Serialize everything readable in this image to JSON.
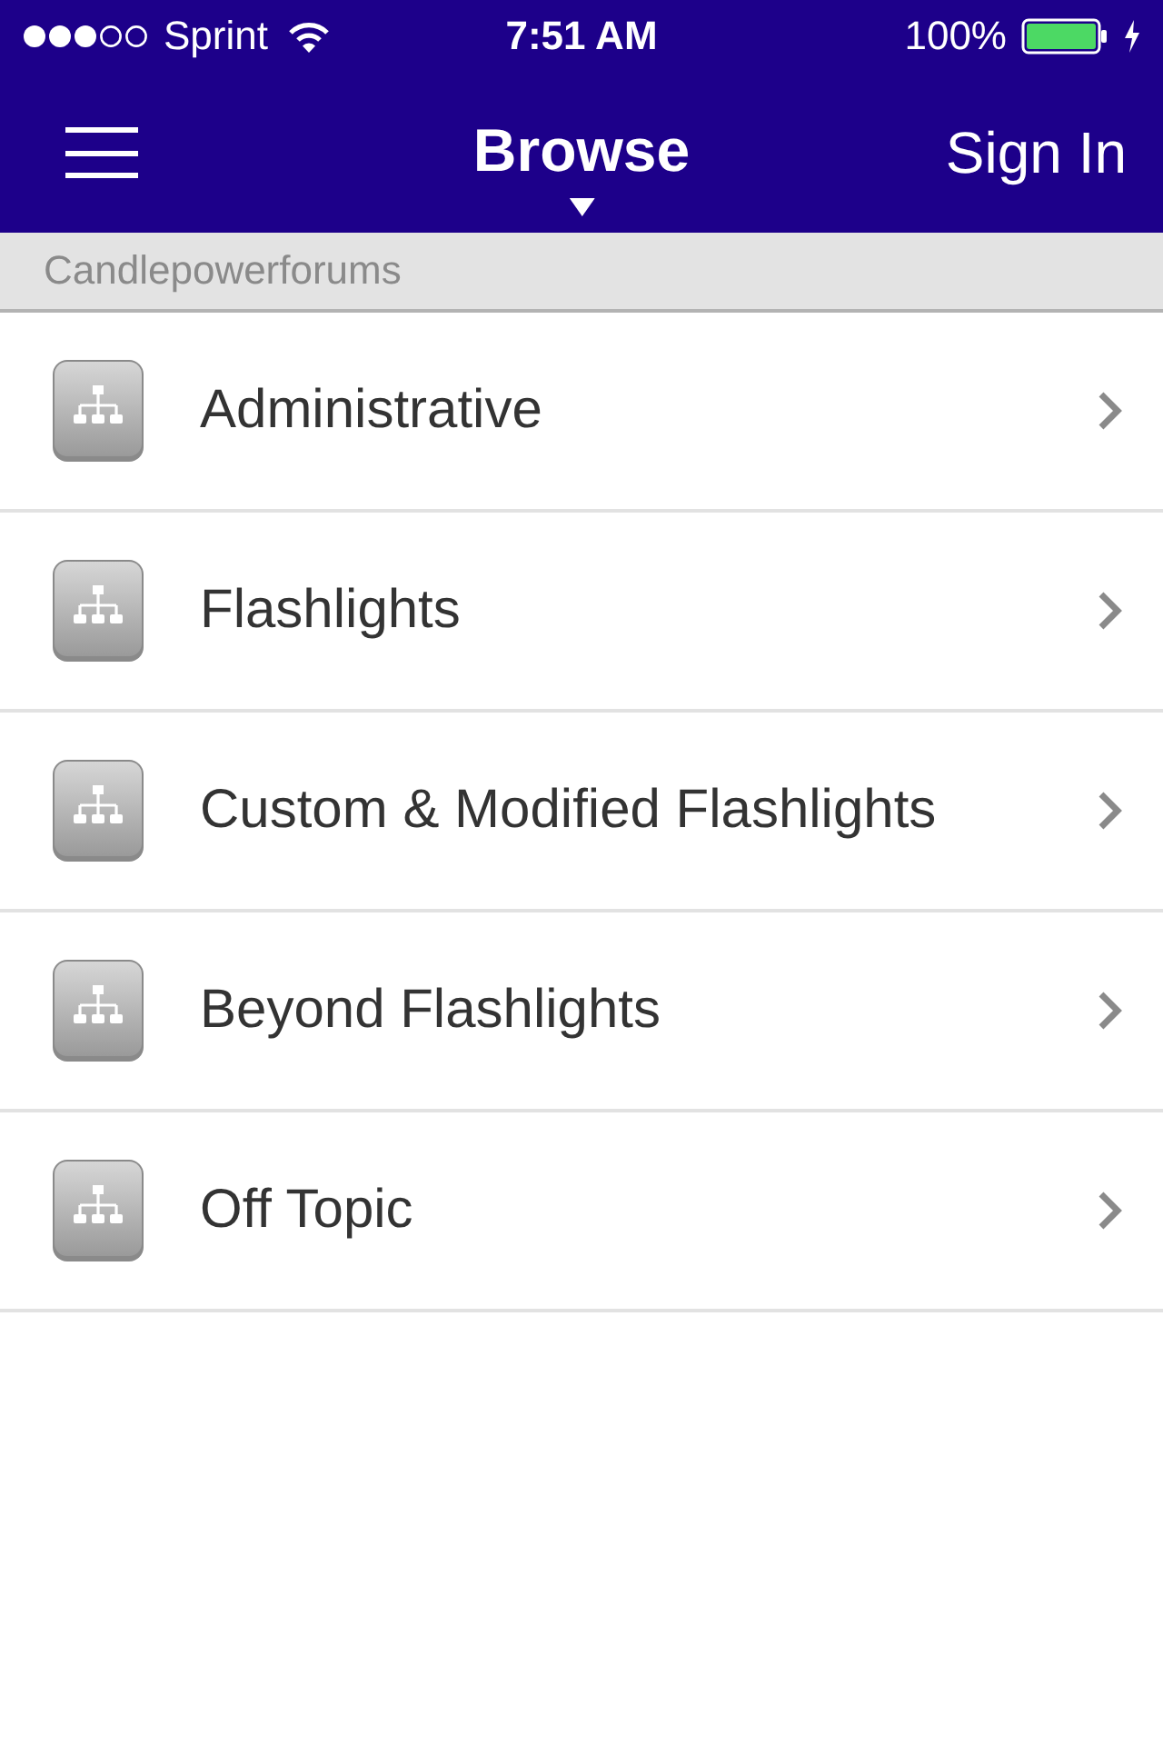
{
  "status_bar": {
    "carrier": "Sprint",
    "time": "7:51 AM",
    "battery": "100%"
  },
  "nav_bar": {
    "title": "Browse",
    "action": "Sign In"
  },
  "section": {
    "title": "Candlepowerforums"
  },
  "forums": [
    {
      "title": "Administrative"
    },
    {
      "title": "Flashlights"
    },
    {
      "title": "Custom & Modified Flashlights"
    },
    {
      "title": "Beyond Flashlights"
    },
    {
      "title": "Off Topic"
    }
  ]
}
